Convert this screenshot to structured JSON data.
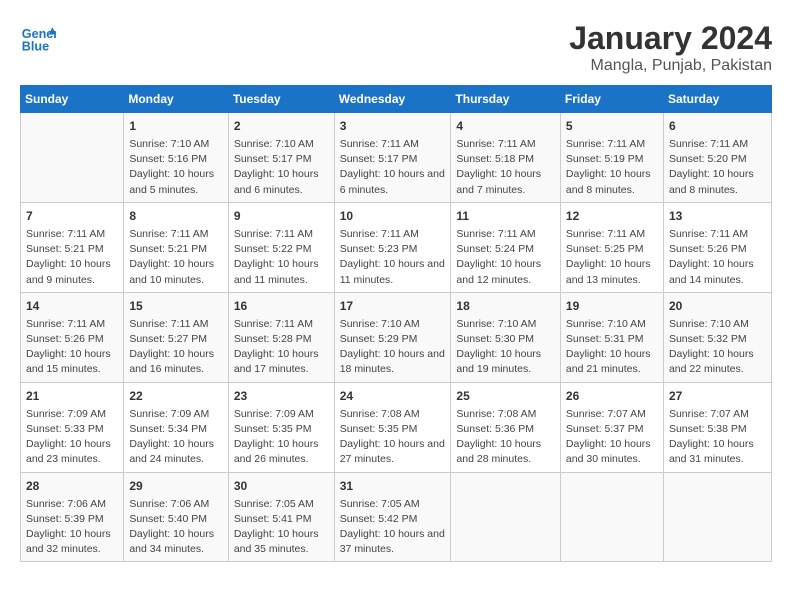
{
  "app": {
    "name": "General",
    "name2": "Blue"
  },
  "title": "January 2024",
  "subtitle": "Mangla, Punjab, Pakistan",
  "headers": [
    "Sunday",
    "Monday",
    "Tuesday",
    "Wednesday",
    "Thursday",
    "Friday",
    "Saturday"
  ],
  "weeks": [
    [
      {
        "day": "",
        "sunrise": "",
        "sunset": "",
        "daylight": ""
      },
      {
        "day": "1",
        "sunrise": "Sunrise: 7:10 AM",
        "sunset": "Sunset: 5:16 PM",
        "daylight": "Daylight: 10 hours and 5 minutes."
      },
      {
        "day": "2",
        "sunrise": "Sunrise: 7:10 AM",
        "sunset": "Sunset: 5:17 PM",
        "daylight": "Daylight: 10 hours and 6 minutes."
      },
      {
        "day": "3",
        "sunrise": "Sunrise: 7:11 AM",
        "sunset": "Sunset: 5:17 PM",
        "daylight": "Daylight: 10 hours and 6 minutes."
      },
      {
        "day": "4",
        "sunrise": "Sunrise: 7:11 AM",
        "sunset": "Sunset: 5:18 PM",
        "daylight": "Daylight: 10 hours and 7 minutes."
      },
      {
        "day": "5",
        "sunrise": "Sunrise: 7:11 AM",
        "sunset": "Sunset: 5:19 PM",
        "daylight": "Daylight: 10 hours and 8 minutes."
      },
      {
        "day": "6",
        "sunrise": "Sunrise: 7:11 AM",
        "sunset": "Sunset: 5:20 PM",
        "daylight": "Daylight: 10 hours and 8 minutes."
      }
    ],
    [
      {
        "day": "7",
        "sunrise": "Sunrise: 7:11 AM",
        "sunset": "Sunset: 5:21 PM",
        "daylight": "Daylight: 10 hours and 9 minutes."
      },
      {
        "day": "8",
        "sunrise": "Sunrise: 7:11 AM",
        "sunset": "Sunset: 5:21 PM",
        "daylight": "Daylight: 10 hours and 10 minutes."
      },
      {
        "day": "9",
        "sunrise": "Sunrise: 7:11 AM",
        "sunset": "Sunset: 5:22 PM",
        "daylight": "Daylight: 10 hours and 11 minutes."
      },
      {
        "day": "10",
        "sunrise": "Sunrise: 7:11 AM",
        "sunset": "Sunset: 5:23 PM",
        "daylight": "Daylight: 10 hours and 11 minutes."
      },
      {
        "day": "11",
        "sunrise": "Sunrise: 7:11 AM",
        "sunset": "Sunset: 5:24 PM",
        "daylight": "Daylight: 10 hours and 12 minutes."
      },
      {
        "day": "12",
        "sunrise": "Sunrise: 7:11 AM",
        "sunset": "Sunset: 5:25 PM",
        "daylight": "Daylight: 10 hours and 13 minutes."
      },
      {
        "day": "13",
        "sunrise": "Sunrise: 7:11 AM",
        "sunset": "Sunset: 5:26 PM",
        "daylight": "Daylight: 10 hours and 14 minutes."
      }
    ],
    [
      {
        "day": "14",
        "sunrise": "Sunrise: 7:11 AM",
        "sunset": "Sunset: 5:26 PM",
        "daylight": "Daylight: 10 hours and 15 minutes."
      },
      {
        "day": "15",
        "sunrise": "Sunrise: 7:11 AM",
        "sunset": "Sunset: 5:27 PM",
        "daylight": "Daylight: 10 hours and 16 minutes."
      },
      {
        "day": "16",
        "sunrise": "Sunrise: 7:11 AM",
        "sunset": "Sunset: 5:28 PM",
        "daylight": "Daylight: 10 hours and 17 minutes."
      },
      {
        "day": "17",
        "sunrise": "Sunrise: 7:10 AM",
        "sunset": "Sunset: 5:29 PM",
        "daylight": "Daylight: 10 hours and 18 minutes."
      },
      {
        "day": "18",
        "sunrise": "Sunrise: 7:10 AM",
        "sunset": "Sunset: 5:30 PM",
        "daylight": "Daylight: 10 hours and 19 minutes."
      },
      {
        "day": "19",
        "sunrise": "Sunrise: 7:10 AM",
        "sunset": "Sunset: 5:31 PM",
        "daylight": "Daylight: 10 hours and 21 minutes."
      },
      {
        "day": "20",
        "sunrise": "Sunrise: 7:10 AM",
        "sunset": "Sunset: 5:32 PM",
        "daylight": "Daylight: 10 hours and 22 minutes."
      }
    ],
    [
      {
        "day": "21",
        "sunrise": "Sunrise: 7:09 AM",
        "sunset": "Sunset: 5:33 PM",
        "daylight": "Daylight: 10 hours and 23 minutes."
      },
      {
        "day": "22",
        "sunrise": "Sunrise: 7:09 AM",
        "sunset": "Sunset: 5:34 PM",
        "daylight": "Daylight: 10 hours and 24 minutes."
      },
      {
        "day": "23",
        "sunrise": "Sunrise: 7:09 AM",
        "sunset": "Sunset: 5:35 PM",
        "daylight": "Daylight: 10 hours and 26 minutes."
      },
      {
        "day": "24",
        "sunrise": "Sunrise: 7:08 AM",
        "sunset": "Sunset: 5:35 PM",
        "daylight": "Daylight: 10 hours and 27 minutes."
      },
      {
        "day": "25",
        "sunrise": "Sunrise: 7:08 AM",
        "sunset": "Sunset: 5:36 PM",
        "daylight": "Daylight: 10 hours and 28 minutes."
      },
      {
        "day": "26",
        "sunrise": "Sunrise: 7:07 AM",
        "sunset": "Sunset: 5:37 PM",
        "daylight": "Daylight: 10 hours and 30 minutes."
      },
      {
        "day": "27",
        "sunrise": "Sunrise: 7:07 AM",
        "sunset": "Sunset: 5:38 PM",
        "daylight": "Daylight: 10 hours and 31 minutes."
      }
    ],
    [
      {
        "day": "28",
        "sunrise": "Sunrise: 7:06 AM",
        "sunset": "Sunset: 5:39 PM",
        "daylight": "Daylight: 10 hours and 32 minutes."
      },
      {
        "day": "29",
        "sunrise": "Sunrise: 7:06 AM",
        "sunset": "Sunset: 5:40 PM",
        "daylight": "Daylight: 10 hours and 34 minutes."
      },
      {
        "day": "30",
        "sunrise": "Sunrise: 7:05 AM",
        "sunset": "Sunset: 5:41 PM",
        "daylight": "Daylight: 10 hours and 35 minutes."
      },
      {
        "day": "31",
        "sunrise": "Sunrise: 7:05 AM",
        "sunset": "Sunset: 5:42 PM",
        "daylight": "Daylight: 10 hours and 37 minutes."
      },
      {
        "day": "",
        "sunrise": "",
        "sunset": "",
        "daylight": ""
      },
      {
        "day": "",
        "sunrise": "",
        "sunset": "",
        "daylight": ""
      },
      {
        "day": "",
        "sunrise": "",
        "sunset": "",
        "daylight": ""
      }
    ]
  ]
}
